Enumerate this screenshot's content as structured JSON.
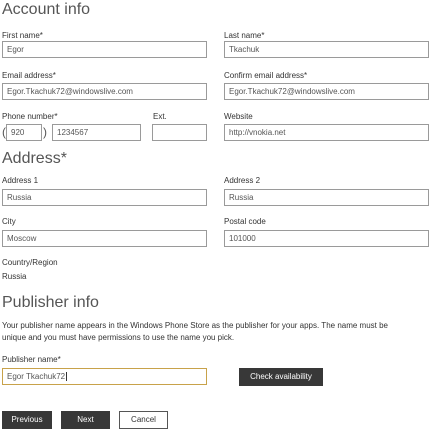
{
  "account": {
    "heading": "Account info",
    "first_name": {
      "label": "First name*",
      "value": "Egor"
    },
    "last_name": {
      "label": "Last name*",
      "value": "Tkachuk"
    },
    "email": {
      "label": "Email address*",
      "value": "Egor.Tkachuk72@windowslive.com"
    },
    "confirm_email": {
      "label": "Confirm email address*",
      "value": "Egor.Tkachuk72@windowslive.com"
    },
    "phone": {
      "label": "Phone number*",
      "open_paren": "(",
      "area_code": "920",
      "close_paren": ")",
      "number": "1234567"
    },
    "ext": {
      "label": "Ext.",
      "value": ""
    },
    "website": {
      "label": "Website",
      "value": "http://vnokia.net"
    }
  },
  "address": {
    "heading": "Address*",
    "address1": {
      "label": "Address 1",
      "value": "Russia"
    },
    "address2": {
      "label": "Address 2",
      "value": "Russia"
    },
    "city": {
      "label": "City",
      "value": "Moscow"
    },
    "postal_code": {
      "label": "Postal code",
      "value": "101000"
    },
    "country": {
      "label": "Country/Region",
      "value": "Russia"
    }
  },
  "publisher": {
    "heading": "Publisher info",
    "description_line1": "Your publisher name appears in the Windows Phone Store as the publisher for your apps. The name must be",
    "description_line2": "unique and you must have permissions to use the name you pick.",
    "name": {
      "label": "Publisher name*",
      "value": "Egor Tkachuk72"
    },
    "check_button": "Check availability"
  },
  "footer": {
    "previous": "Previous",
    "next": "Next",
    "cancel": "Cancel"
  },
  "colors": {
    "dark_button": "#383838",
    "focus_border": "#c8a24a",
    "input_border": "#9a9a9a"
  }
}
